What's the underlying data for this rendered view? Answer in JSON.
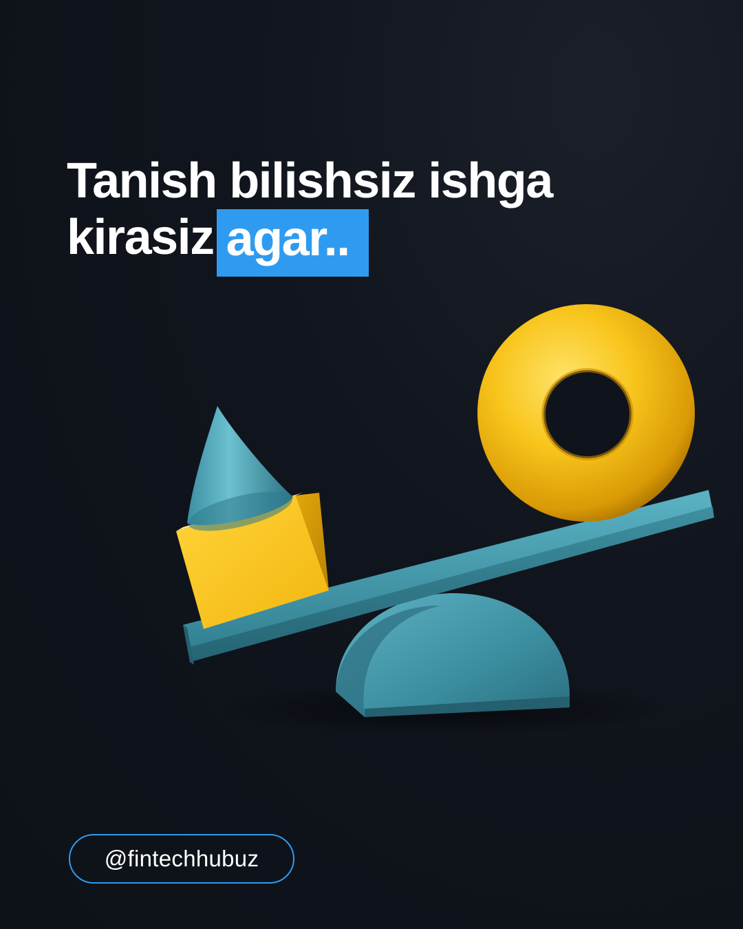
{
  "headline": {
    "line1": "Tanish bilishsiz ishga",
    "line2_prefix": "kirasiz",
    "line2_highlight": "agar.."
  },
  "handle": {
    "label": "@fintechhubuz"
  },
  "colors": {
    "background": "#10141c",
    "accent": "#2f9bf0",
    "shape_yellow": "#f7c21b",
    "shape_teal": "#3f97a8",
    "text": "#ffffff"
  }
}
